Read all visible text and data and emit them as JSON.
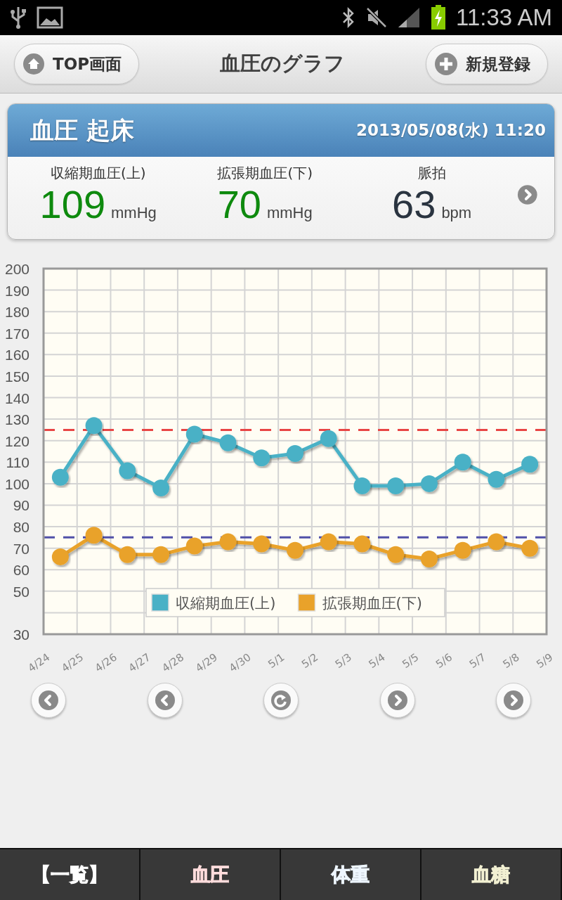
{
  "status_bar": {
    "time": "11:33 AM"
  },
  "header": {
    "left_button": "TOP画面",
    "title": "血圧のグラフ",
    "right_button": "新規登録"
  },
  "record": {
    "title": "血圧 起床",
    "datetime": "2013/05/08(水) 11:20",
    "readings": [
      {
        "label": "収縮期血圧(上)",
        "value": "109",
        "unit": "mmHg",
        "kind": "pressure"
      },
      {
        "label": "拡張期血圧(下)",
        "value": "70",
        "unit": "mmHg",
        "kind": "pressure"
      },
      {
        "label": "脈拍",
        "value": "63",
        "unit": "bpm",
        "kind": "pulse"
      }
    ]
  },
  "chart": {
    "chart_data": {
      "type": "line",
      "categories": [
        "4/24",
        null,
        "4/25",
        null,
        "4/26",
        null,
        "4/27",
        null,
        "4/28",
        null,
        "4/29",
        null,
        "4/30",
        null,
        "5/1",
        null,
        "5/2",
        null,
        "5/3",
        null,
        "5/4",
        null,
        "5/5",
        null,
        "5/6",
        null,
        "5/7",
        null,
        "5/8",
        null,
        "5/9"
      ],
      "ylim": [
        30,
        200
      ],
      "grid": true,
      "legend": true,
      "yticks": [
        30,
        50,
        60,
        70,
        80,
        90,
        100,
        110,
        120,
        130,
        140,
        150,
        160,
        170,
        180,
        190,
        200
      ],
      "series": [
        {
          "name": "収縮期血圧(上)",
          "color": "#4ab1c6",
          "marker": "o",
          "values": [
            null,
            103,
            null,
            127,
            null,
            106,
            null,
            98,
            null,
            123,
            null,
            119,
            null,
            112,
            null,
            114,
            null,
            121,
            null,
            99,
            null,
            99,
            null,
            100,
            null,
            110,
            null,
            102,
            null,
            109,
            null
          ]
        },
        {
          "name": "拡張期血圧(下)",
          "color": "#e9a22a",
          "marker": "o",
          "values": [
            null,
            66,
            null,
            76,
            null,
            67,
            null,
            67,
            null,
            71,
            null,
            73,
            null,
            72,
            null,
            69,
            null,
            73,
            null,
            72,
            null,
            67,
            null,
            65,
            null,
            69,
            null,
            73,
            null,
            70,
            null
          ]
        }
      ],
      "ref_lines": [
        {
          "axis": "y",
          "value": 125,
          "color": "#e84545"
        },
        {
          "axis": "y",
          "value": 75,
          "color": "#5050a8"
        }
      ]
    }
  },
  "nav_buttons": [
    {
      "kind": "back"
    },
    {
      "kind": "back"
    },
    {
      "kind": "refresh"
    },
    {
      "kind": "forward"
    },
    {
      "kind": "forward"
    }
  ],
  "tabs": [
    {
      "label": "【一覧】",
      "color": "#ffffff"
    },
    {
      "label": "血圧",
      "color": "#ffdcdc"
    },
    {
      "label": "体重",
      "color": "#eef6ff"
    },
    {
      "label": "血糖",
      "color": "#f2f0d2"
    }
  ]
}
